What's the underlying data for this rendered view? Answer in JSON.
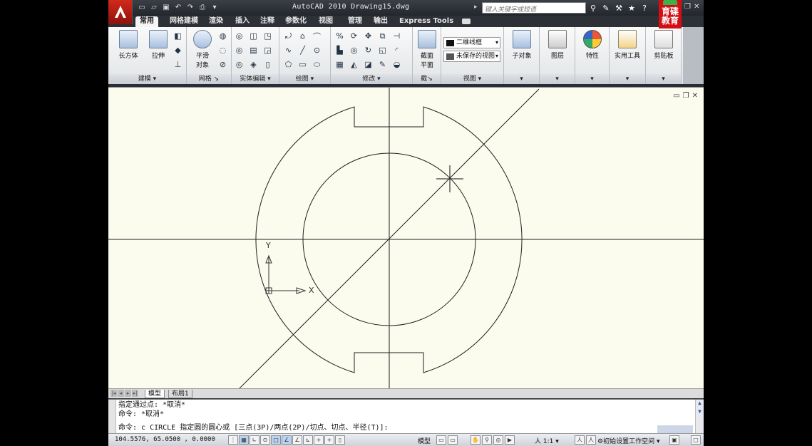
{
  "window": {
    "title": "AutoCAD 2010  Drawing15.dwg",
    "search_placeholder": "键入关键字或短语",
    "logo_text": [
      "育",
      "碟",
      "教",
      "育"
    ]
  },
  "tabs": [
    "常用",
    "网格建模",
    "渲染",
    "插入",
    "注释",
    "参数化",
    "视图",
    "管理",
    "输出",
    "Express Tools"
  ],
  "ribbon": {
    "panels": [
      "建模",
      "网格",
      "实体编辑",
      "绘图",
      "修改",
      "截",
      "视图"
    ],
    "tools": {
      "box": "长方体",
      "extrude": "拉伸",
      "smooth_line1": "平滑",
      "smooth_line2": "对象",
      "section_line1": "截面",
      "section_line2": "平面",
      "visual_style": "二维线框",
      "view": "未保存的视图",
      "subobject": "子对象",
      "layers": "图层",
      "properties": "特性",
      "utilities": "实用工具",
      "clipboard": "剪贴板"
    }
  },
  "drawing": {
    "ucs_x": "X",
    "ucs_y": "Y"
  },
  "layout_tabs": [
    "模型",
    "布局1"
  ],
  "command": {
    "history": [
      "指定通过点: *取消*",
      "命令: *取消*"
    ],
    "prompt": "命令: c CIRCLE 指定圆的圆心或 [三点(3P)/两点(2P)/切点、切点、半径(T)]:"
  },
  "status": {
    "coordinates": "104.5576, 65.0500 , 0.0000",
    "model_label": "模型",
    "annotation_scale": "1:1",
    "workspace": "初始设置工作空间"
  }
}
